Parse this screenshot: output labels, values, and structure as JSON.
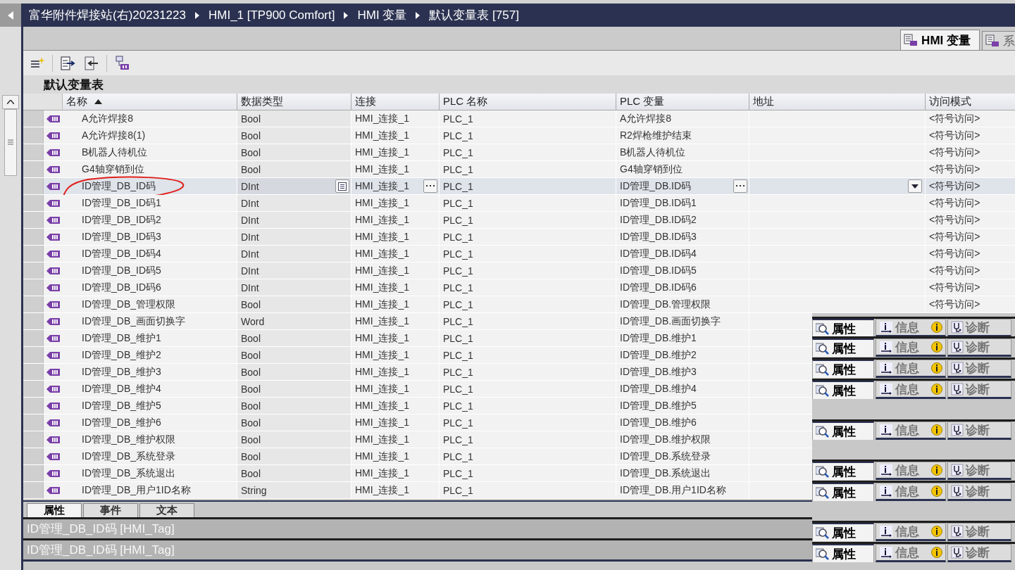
{
  "breadcrumb": [
    "富华附件焊接站(右)20231223",
    "HMI_1 [TP900 Comfort]",
    "HMI 变量",
    "默认变量表 [757]"
  ],
  "editor_tabs": [
    {
      "label": "HMI 变量",
      "selected": true
    },
    {
      "label": "系",
      "selected": false
    }
  ],
  "table_title": "默认变量表",
  "table": {
    "columns": [
      "名称",
      "数据类型",
      "连接",
      "PLC 名称",
      "PLC 变量",
      "地址",
      "访问模式"
    ],
    "rows": [
      {
        "name": "A允许焊接8",
        "type": "Bool",
        "connection": "HMI_连接_1",
        "plc_name": "PLC_1",
        "plc_tag": "A允许焊接8",
        "access": "<符号访问>",
        "selected": false,
        "circled": false
      },
      {
        "name": "A允许焊接8(1)",
        "type": "Bool",
        "connection": "HMI_连接_1",
        "plc_name": "PLC_1",
        "plc_tag": "R2焊枪维护结束",
        "access": "<符号访问>",
        "selected": false,
        "circled": false
      },
      {
        "name": "B机器人待机位",
        "type": "Bool",
        "connection": "HMI_连接_1",
        "plc_name": "PLC_1",
        "plc_tag": "B机器人待机位",
        "access": "<符号访问>",
        "selected": false,
        "circled": false
      },
      {
        "name": "G4轴穿销到位",
        "type": "Bool",
        "connection": "HMI_连接_1",
        "plc_name": "PLC_1",
        "plc_tag": "G4轴穿销到位",
        "access": "<符号访问>",
        "selected": false,
        "circled": false
      },
      {
        "name": "ID管理_DB_ID码",
        "type": "DInt",
        "connection": "HMI_连接_1",
        "plc_name": "PLC_1",
        "plc_tag": "ID管理_DB.ID码",
        "access": "<符号访问>",
        "selected": true,
        "circled": true
      },
      {
        "name": "ID管理_DB_ID码1",
        "type": "DInt",
        "connection": "HMI_连接_1",
        "plc_name": "PLC_1",
        "plc_tag": "ID管理_DB.ID码1",
        "access": "<符号访问>",
        "selected": false,
        "circled": false
      },
      {
        "name": "ID管理_DB_ID码2",
        "type": "DInt",
        "connection": "HMI_连接_1",
        "plc_name": "PLC_1",
        "plc_tag": "ID管理_DB.ID码2",
        "access": "<符号访问>",
        "selected": false,
        "circled": false
      },
      {
        "name": "ID管理_DB_ID码3",
        "type": "DInt",
        "connection": "HMI_连接_1",
        "plc_name": "PLC_1",
        "plc_tag": "ID管理_DB.ID码3",
        "access": "<符号访问>",
        "selected": false,
        "circled": false
      },
      {
        "name": "ID管理_DB_ID码4",
        "type": "DInt",
        "connection": "HMI_连接_1",
        "plc_name": "PLC_1",
        "plc_tag": "ID管理_DB.ID码4",
        "access": "<符号访问>",
        "selected": false,
        "circled": false
      },
      {
        "name": "ID管理_DB_ID码5",
        "type": "DInt",
        "connection": "HMI_连接_1",
        "plc_name": "PLC_1",
        "plc_tag": "ID管理_DB.ID码5",
        "access": "<符号访问>",
        "selected": false,
        "circled": false
      },
      {
        "name": "ID管理_DB_ID码6",
        "type": "DInt",
        "connection": "HMI_连接_1",
        "plc_name": "PLC_1",
        "plc_tag": "ID管理_DB.ID码6",
        "access": "<符号访问>",
        "selected": false,
        "circled": false
      },
      {
        "name": "ID管理_DB_管理权限",
        "type": "Bool",
        "connection": "HMI_连接_1",
        "plc_name": "PLC_1",
        "plc_tag": "ID管理_DB.管理权限",
        "access": "<符号访问>",
        "selected": false,
        "circled": false
      },
      {
        "name": "ID管理_DB_画面切换字",
        "type": "Word",
        "connection": "HMI_连接_1",
        "plc_name": "PLC_1",
        "plc_tag": "ID管理_DB.画面切换字",
        "selected": false,
        "circled": false
      },
      {
        "name": "ID管理_DB_维护1",
        "type": "Bool",
        "connection": "HMI_连接_1",
        "plc_name": "PLC_1",
        "plc_tag": "ID管理_DB.维护1",
        "selected": false,
        "circled": false
      },
      {
        "name": "ID管理_DB_维护2",
        "type": "Bool",
        "connection": "HMI_连接_1",
        "plc_name": "PLC_1",
        "plc_tag": "ID管理_DB.维护2",
        "selected": false,
        "circled": false
      },
      {
        "name": "ID管理_DB_维护3",
        "type": "Bool",
        "connection": "HMI_连接_1",
        "plc_name": "PLC_1",
        "plc_tag": "ID管理_DB.维护3",
        "selected": false,
        "circled": false
      },
      {
        "name": "ID管理_DB_维护4",
        "type": "Bool",
        "connection": "HMI_连接_1",
        "plc_name": "PLC_1",
        "plc_tag": "ID管理_DB.维护4",
        "selected": false,
        "circled": false
      },
      {
        "name": "ID管理_DB_维护5",
        "type": "Bool",
        "connection": "HMI_连接_1",
        "plc_name": "PLC_1",
        "plc_tag": "ID管理_DB.维护5",
        "selected": false,
        "circled": false
      },
      {
        "name": "ID管理_DB_维护6",
        "type": "Bool",
        "connection": "HMI_连接_1",
        "plc_name": "PLC_1",
        "plc_tag": "ID管理_DB.维护6",
        "selected": false,
        "circled": false
      },
      {
        "name": "ID管理_DB_维护权限",
        "type": "Bool",
        "connection": "HMI_连接_1",
        "plc_name": "PLC_1",
        "plc_tag": "ID管理_DB.维护权限",
        "selected": false,
        "circled": false
      },
      {
        "name": "ID管理_DB_系统登录",
        "type": "Bool",
        "connection": "HMI_连接_1",
        "plc_name": "PLC_1",
        "plc_tag": "ID管理_DB.系统登录",
        "selected": false,
        "circled": false
      },
      {
        "name": "ID管理_DB_系统退出",
        "type": "Bool",
        "connection": "HMI_连接_1",
        "plc_name": "PLC_1",
        "plc_tag": "ID管理_DB.系统退出",
        "selected": false,
        "circled": false
      },
      {
        "name": "ID管理_DB_用户1ID名称",
        "type": "String",
        "connection": "HMI_连接_1",
        "plc_name": "PLC_1",
        "plc_tag": "ID管理_DB.用户1ID名称",
        "selected": false,
        "circled": false
      }
    ]
  },
  "bottom_tabs": [
    {
      "label": "属性",
      "selected": true
    },
    {
      "label": "事件",
      "selected": false
    },
    {
      "label": "文本",
      "selected": false
    }
  ],
  "object_bars": [
    "ID管理_DB_ID码 [HMI_Tag]",
    "ID管理_DB_ID码 [HMI_Tag]"
  ],
  "inspector_strips": [
    {
      "tabs": [
        {
          "label": "属性",
          "selected": true
        },
        {
          "label": "信息",
          "selected": false
        },
        {
          "label": "诊断",
          "selected": false
        }
      ]
    },
    {
      "tabs": [
        {
          "label": "属性",
          "selected": true
        },
        {
          "label": "信息",
          "selected": false
        },
        {
          "label": "诊断",
          "selected": false
        }
      ]
    },
    {
      "tabs": [
        {
          "label": "属性",
          "selected": true
        },
        {
          "label": "信息",
          "selected": false
        },
        {
          "label": "诊断",
          "selected": false
        }
      ]
    },
    {
      "tabs": [
        {
          "label": "属性",
          "selected": true
        },
        {
          "label": "信息",
          "selected": false
        },
        {
          "label": "诊断",
          "selected": false
        }
      ]
    },
    {
      "tabs": [
        {
          "label": "属性",
          "selected": true
        },
        {
          "label": "信息",
          "selected": false
        },
        {
          "label": "诊断",
          "selected": false
        }
      ]
    },
    {
      "tabs": [
        {
          "label": "属性",
          "selected": true
        },
        {
          "label": "信息",
          "selected": false
        },
        {
          "label": "诊断",
          "selected": false
        }
      ]
    },
    {
      "tabs": [
        {
          "label": "属性",
          "selected": true
        },
        {
          "label": "信息",
          "selected": false
        },
        {
          "label": "诊断",
          "selected": false
        }
      ]
    },
    {
      "tabs": [
        {
          "label": "属性",
          "selected": true
        },
        {
          "label": "信息",
          "selected": false
        },
        {
          "label": "诊断",
          "selected": false
        }
      ]
    },
    {
      "tabs": [
        {
          "label": "属性",
          "selected": true
        },
        {
          "label": "信息",
          "selected": false
        },
        {
          "label": "诊断",
          "selected": false
        }
      ]
    }
  ]
}
